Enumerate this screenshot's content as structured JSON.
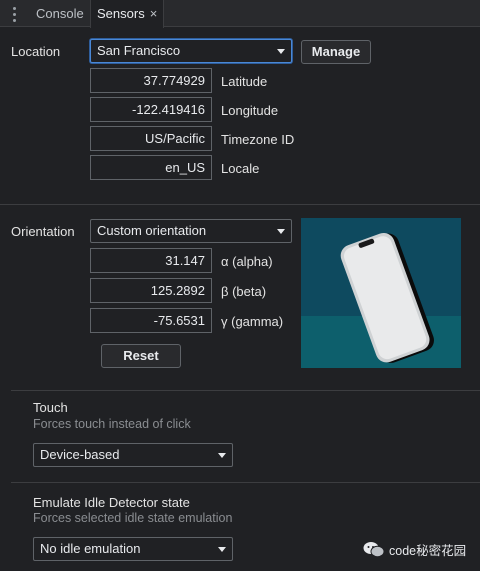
{
  "tabs": [
    {
      "label": "Console",
      "active": false
    },
    {
      "label": "Sensors",
      "active": true,
      "close": "×"
    }
  ],
  "location": {
    "label": "Location",
    "selected": "San Francisco",
    "manage_label": "Manage",
    "fields": [
      {
        "value": "37.774929",
        "label": "Latitude"
      },
      {
        "value": "-122.419416",
        "label": "Longitude"
      },
      {
        "value": "US/Pacific",
        "label": "Timezone ID"
      },
      {
        "value": "en_US",
        "label": "Locale"
      }
    ]
  },
  "orientation": {
    "label": "Orientation",
    "selected": "Custom orientation",
    "fields": [
      {
        "value": "31.147",
        "label": "α (alpha)"
      },
      {
        "value": "125.2892",
        "label": "β (beta)"
      },
      {
        "value": "-75.6531",
        "label": "γ (gamma)"
      }
    ],
    "reset_label": "Reset"
  },
  "touch": {
    "title": "Touch",
    "description": "Forces touch instead of click",
    "selected": "Device-based"
  },
  "idle": {
    "title": "Emulate Idle Detector state",
    "description": "Forces selected idle state emulation",
    "selected": "No idle emulation"
  },
  "watermark": {
    "text": "code秘密花园"
  },
  "colors": {
    "background": "#202124",
    "accent_focus": "#4a88d6",
    "phone_sky": "#0e4a5f",
    "phone_ground": "#0d5f6c"
  }
}
